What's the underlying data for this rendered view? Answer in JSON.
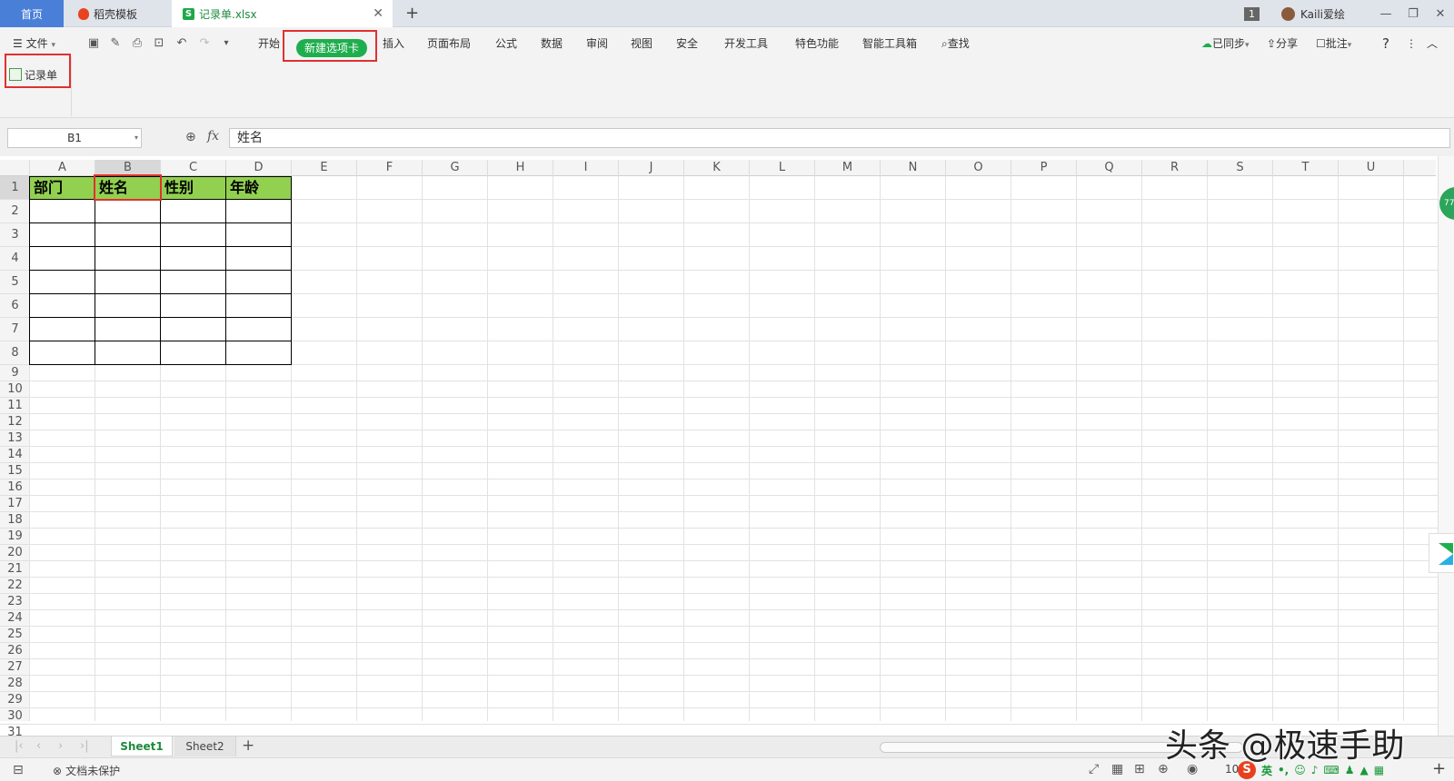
{
  "titlebar": {
    "tabs": [
      {
        "label": "首页"
      },
      {
        "label": "稻壳模板"
      },
      {
        "label": "记录单.xlsx"
      }
    ],
    "new_tab": "+",
    "badge": "1",
    "user": "Kaili爱绘",
    "window_buttons": [
      "—",
      "❐",
      "✕"
    ]
  },
  "ribbon": {
    "file_menu": "文件",
    "tabs": [
      "开始",
      "新建选项卡",
      "插入",
      "页面布局",
      "公式",
      "数据",
      "审阅",
      "视图",
      "安全",
      "开发工具",
      "特色功能",
      "智能工具箱"
    ],
    "search_label": "查找",
    "sync_label": "已同步",
    "share_label": "分享",
    "comment_label": "批注",
    "help": "?",
    "more": "⋮",
    "collapse": "︿",
    "group_button": "记录单"
  },
  "formula_bar": {
    "name_box": "B1",
    "fx_label": "fx",
    "formula": "姓名"
  },
  "sheet": {
    "columns": [
      "A",
      "B",
      "C",
      "D",
      "E",
      "F",
      "G",
      "H",
      "I",
      "J",
      "K",
      "L",
      "M",
      "N",
      "O",
      "P",
      "Q",
      "R",
      "S",
      "T",
      "U"
    ],
    "rows": [
      "1",
      "2",
      "3",
      "4",
      "5",
      "6",
      "7",
      "8",
      "9",
      "10",
      "11",
      "12",
      "13",
      "14",
      "15",
      "16",
      "17",
      "18",
      "19",
      "20",
      "21",
      "22",
      "23",
      "24",
      "25",
      "26",
      "27",
      "28",
      "29",
      "30",
      "31"
    ],
    "header_cells": [
      "部门",
      "姓名",
      "性别",
      "年龄"
    ],
    "selected_cell": "B1",
    "header_fill": "#92d050",
    "side_badge": "77"
  },
  "sheet_tabs": {
    "tabs": [
      "Sheet1",
      "Sheet2"
    ],
    "active": "Sheet1",
    "add": "+"
  },
  "status_bar": {
    "protection": "文档未保护",
    "zoom": "10",
    "ime_logo": "S",
    "ime_lang": "英"
  },
  "watermark": "头条 @极速手助",
  "colors": {
    "accent": "#1fae4d",
    "highlight": "#e03030",
    "home_tab": "#4a7fd8"
  }
}
